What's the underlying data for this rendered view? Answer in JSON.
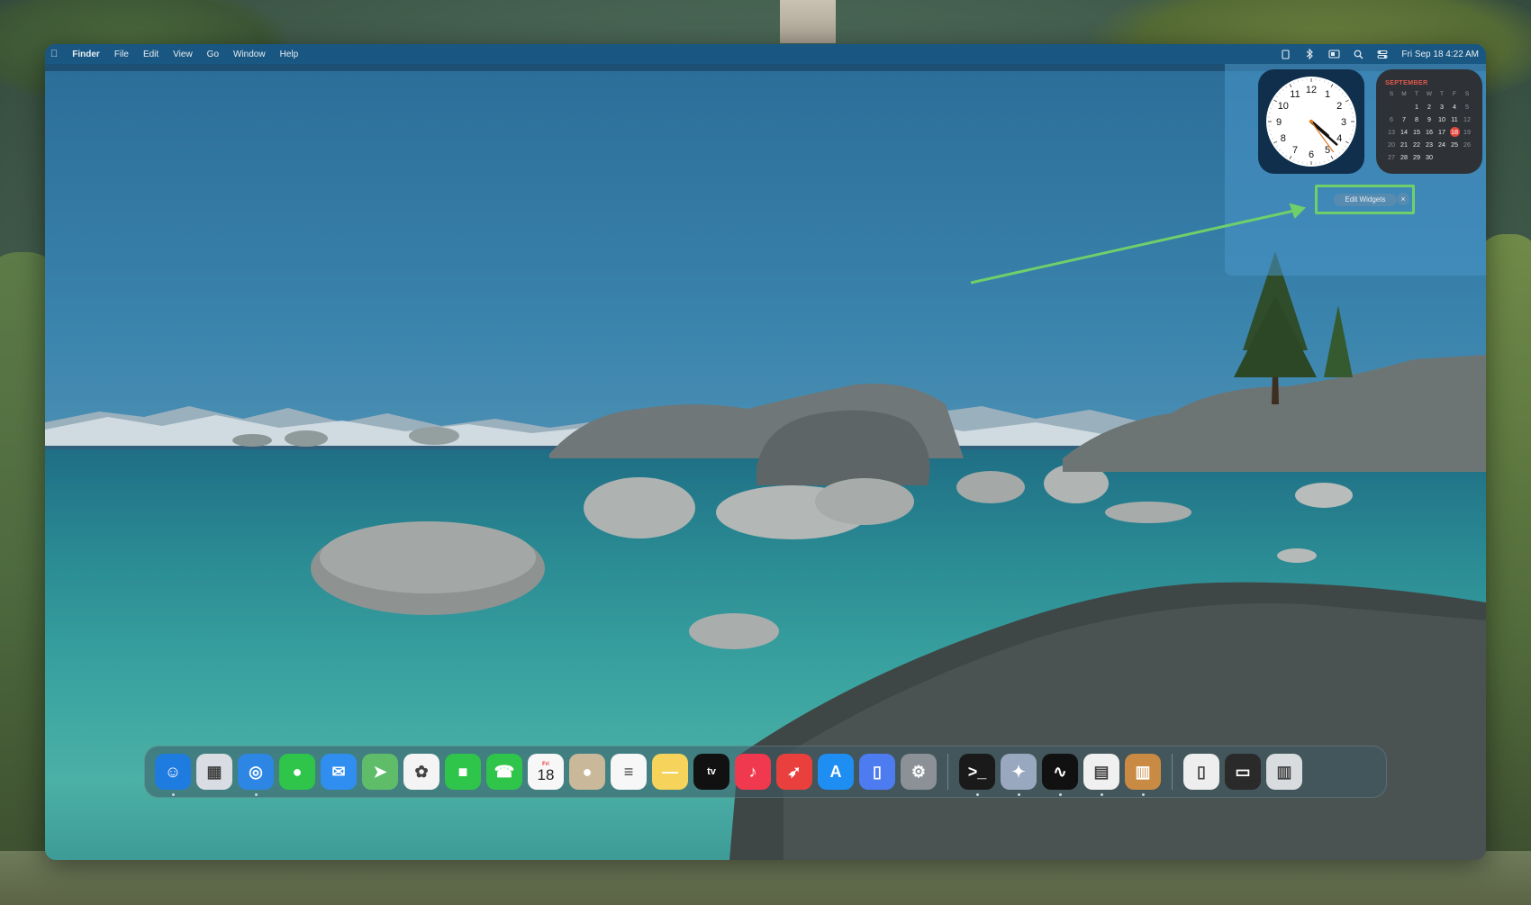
{
  "menubar": {
    "apple": "",
    "app_name": "Finder",
    "menus": [
      "File",
      "Edit",
      "View",
      "Go",
      "Window",
      "Help"
    ],
    "datetime": "Fri Sep 18  4:22 AM",
    "status_icons": [
      "notes-icon",
      "bluetooth-icon",
      "display-icon",
      "search-icon",
      "control-center-icon"
    ]
  },
  "widgets": {
    "clock": {
      "numbers": [
        "12",
        "1",
        "2",
        "3",
        "4",
        "5",
        "6",
        "7",
        "8",
        "9",
        "10",
        "11"
      ],
      "hour": 4,
      "minute": 22,
      "second": 24
    },
    "calendar": {
      "month": "SEPTEMBER",
      "weekdays": [
        "S",
        "M",
        "T",
        "W",
        "T",
        "F",
        "S"
      ],
      "days": [
        "",
        "",
        "1",
        "2",
        "3",
        "4",
        "5",
        "6",
        "7",
        "8",
        "9",
        "10",
        "11",
        "12",
        "13",
        "14",
        "15",
        "16",
        "17",
        "18",
        "19",
        "20",
        "21",
        "22",
        "23",
        "24",
        "25",
        "26",
        "27",
        "28",
        "29",
        "30",
        "",
        "",
        ""
      ],
      "today": "18"
    },
    "edit_button": "Edit Widgets",
    "close_button": "×"
  },
  "dock": {
    "apps": [
      {
        "name": "finder",
        "icon": "finder-icon",
        "color": "#1e7be0",
        "running": true
      },
      {
        "name": "launchpad",
        "icon": "launchpad-icon",
        "color": "#d9dde3",
        "running": false
      },
      {
        "name": "safari",
        "icon": "safari-icon",
        "color": "#2d86e3",
        "running": true
      },
      {
        "name": "messages",
        "icon": "messages-icon",
        "color": "#2fc54a",
        "running": false
      },
      {
        "name": "mail",
        "icon": "mail-icon",
        "color": "#2f8ef0",
        "running": false
      },
      {
        "name": "maps",
        "icon": "maps-icon",
        "color": "#5fbd6a",
        "running": false
      },
      {
        "name": "photos",
        "icon": "photos-icon",
        "color": "#f4f4f4",
        "running": false
      },
      {
        "name": "facetime",
        "icon": "facetime-icon",
        "color": "#2fc54a",
        "running": false
      },
      {
        "name": "phone",
        "icon": "phone-icon",
        "color": "#2fc54a",
        "running": false
      },
      {
        "name": "calendar",
        "icon": "calendar-icon",
        "color": "#f7f7f7",
        "running": false,
        "label_top": "Fri",
        "label": "18"
      },
      {
        "name": "contacts",
        "icon": "contacts-icon",
        "color": "#c9b99a",
        "running": false
      },
      {
        "name": "reminders",
        "icon": "reminders-icon",
        "color": "#f7f7f7",
        "running": false
      },
      {
        "name": "notes",
        "icon": "notes-icon",
        "color": "#f6d35a",
        "running": false
      },
      {
        "name": "tv",
        "icon": "appletv-icon",
        "color": "#111111",
        "running": false,
        "label": "tv"
      },
      {
        "name": "music",
        "icon": "music-icon",
        "color": "#f0394f",
        "running": false
      },
      {
        "name": "rocket",
        "icon": "rocket-icon",
        "color": "#e9403e",
        "running": false
      },
      {
        "name": "app-store",
        "icon": "appstore-icon",
        "color": "#1e8ef2",
        "running": false
      },
      {
        "name": "iphone-mirroring",
        "icon": "iphone-mirroring-icon",
        "color": "#4d7cf0",
        "running": false
      },
      {
        "name": "system-settings",
        "icon": "settings-icon",
        "color": "#8b9197",
        "running": false
      }
    ],
    "utilities": [
      {
        "name": "terminal",
        "icon": "terminal-icon",
        "color": "#1a1a1a",
        "running": true
      },
      {
        "name": "codeedit",
        "icon": "codeedit-icon",
        "color": "#9aa8bf",
        "running": true
      },
      {
        "name": "activity-monitor",
        "icon": "activity-monitor-icon",
        "color": "#111111",
        "running": true
      },
      {
        "name": "numbers-doc",
        "icon": "spreadsheet-icon",
        "color": "#f0f0f0",
        "running": true
      },
      {
        "name": "toolbox",
        "icon": "toolbox-icon",
        "color": "#c98b43",
        "running": true
      }
    ],
    "stacks": [
      {
        "name": "downloads",
        "icon": "document-icon",
        "color": "#eeeeee"
      },
      {
        "name": "screenshot",
        "icon": "screenshot-icon",
        "color": "#2a2a2a"
      },
      {
        "name": "trash",
        "icon": "trash-icon",
        "color": "#d8dcdf"
      }
    ]
  },
  "colors": {
    "highlight": "#6fd06a",
    "menubar": "#185680",
    "calendar_accent": "#e5584c"
  }
}
